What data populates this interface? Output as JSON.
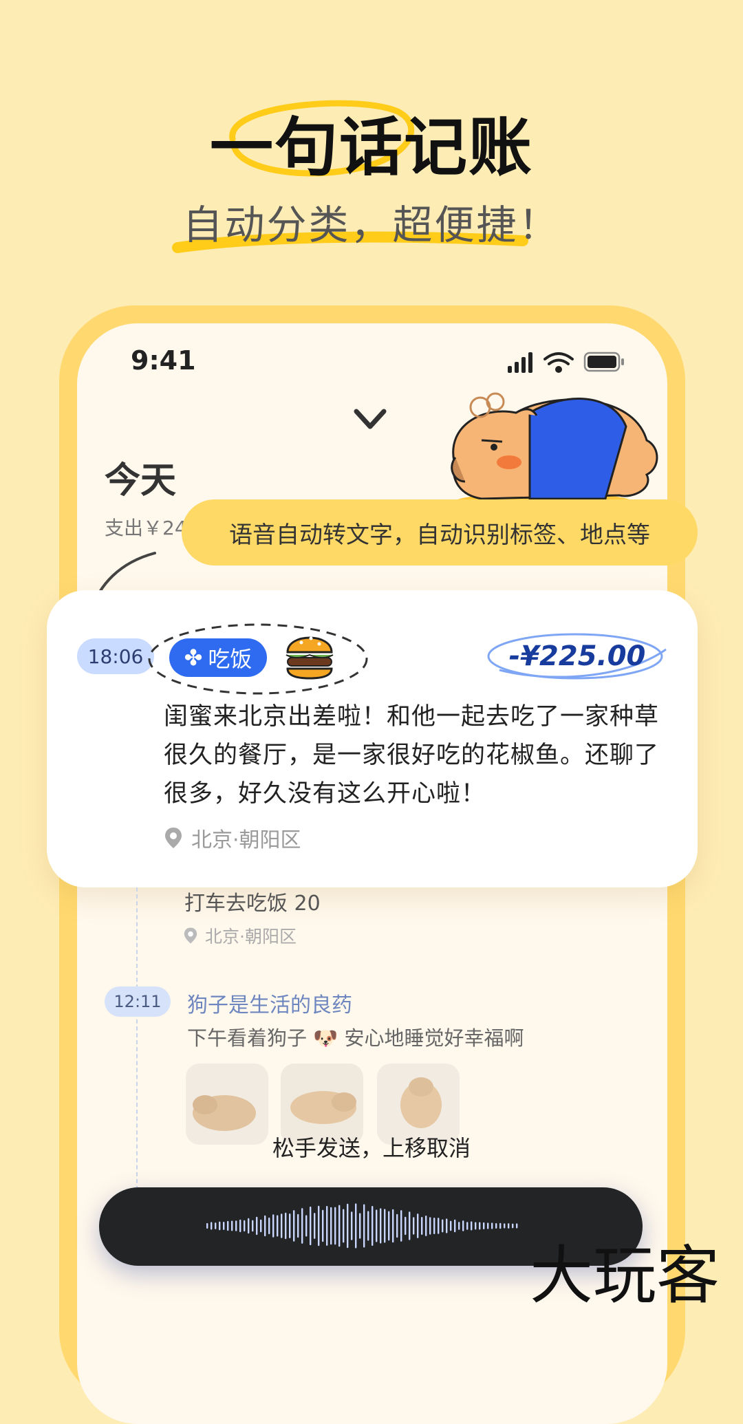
{
  "headline": {
    "title": "一句话记账",
    "subtitle": "自动分类，超便捷！"
  },
  "status_bar": {
    "time": "9:41",
    "icons": [
      "signal-icon",
      "wifi-icon",
      "battery-icon"
    ]
  },
  "day_header": {
    "title": "今天",
    "expense_prefix": "支出￥24"
  },
  "tooltip": "语音自动转文字，自动识别标签、地点等",
  "card": {
    "time": "18:06",
    "tag": "吃饭",
    "tag_icon": "clover-icon",
    "food_icon": "burger-icon",
    "amount": "-¥225.00",
    "text": "闺蜜来北京出差啦！和他一起去吃了一家种草很久的餐厅，是一家很好吃的花椒鱼。还聊了很多，好久没有这么开心啦！",
    "location": "北京·朝阳区"
  },
  "entries": [
    {
      "text": "打车去吃饭 20",
      "location": "北京·朝阳区"
    },
    {
      "time": "12:11",
      "title": "狗子是生活的良药",
      "text": "下午看着狗子 🐶 安心地睡觉好幸福啊"
    }
  ],
  "voice": {
    "hint": "松手发送，上移取消"
  },
  "watermark": "大玩客",
  "colors": {
    "background": "#FEECB5",
    "phone_frame": "#FFD970",
    "accent_blue": "#2E6BF0",
    "amount_blue": "#173C9E",
    "tooltip": "#FFD966",
    "voice_bar": "#222426"
  }
}
